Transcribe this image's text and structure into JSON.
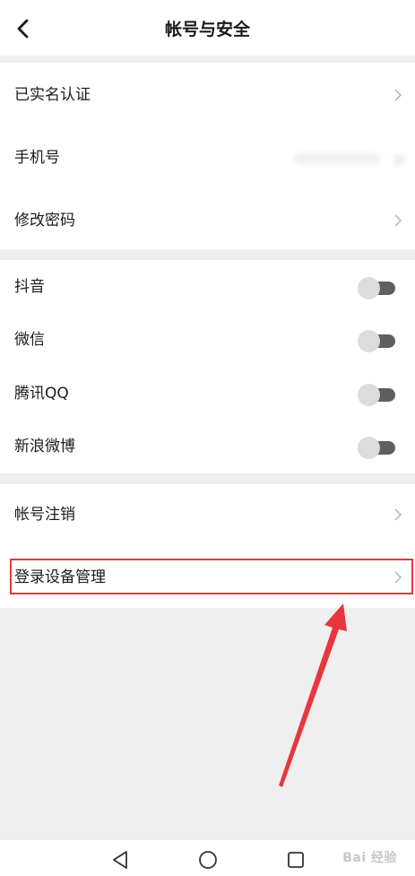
{
  "header": {
    "title": "帐号与安全",
    "back_icon": "chevron-left-icon"
  },
  "groups": [
    {
      "items": [
        {
          "label": "已实名认证",
          "accessory": "chevron"
        },
        {
          "label": "手机号",
          "accessory": "masked-value"
        },
        {
          "label": "修改密码",
          "accessory": "chevron"
        }
      ]
    },
    {
      "items": [
        {
          "label": "抖音",
          "toggle": false
        },
        {
          "label": "微信",
          "toggle": false
        },
        {
          "label": "腾讯QQ",
          "toggle": false
        },
        {
          "label": "新浪微博",
          "toggle": false
        }
      ]
    },
    {
      "items": [
        {
          "label": "帐号注销",
          "accessory": "chevron"
        },
        {
          "label": "登录设备管理",
          "accessory": "chevron"
        }
      ]
    }
  ],
  "annotation": {
    "highlight_color": "#e8373c",
    "arrow_color": "#e8373c"
  },
  "colors": {
    "background": "#efefef",
    "surface": "#ffffff",
    "toggle_track": "#5c6063",
    "toggle_knob": "#dcdcdc"
  },
  "navbar": {
    "icons": [
      "back-triangle-icon",
      "home-circle-icon",
      "recents-square-icon"
    ]
  },
  "watermark": {
    "text": "Bai 经验"
  }
}
